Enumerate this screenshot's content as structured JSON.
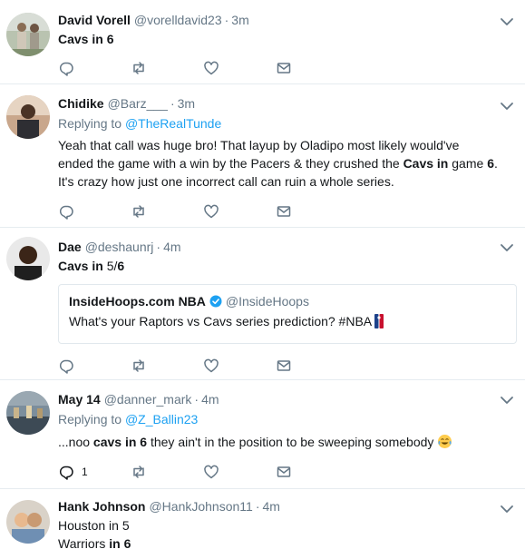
{
  "tweets": [
    {
      "name": "David Vorell",
      "handle": "@vorelldavid23",
      "sep": "·",
      "time": "3m",
      "text_html": "<b>Cavs in 6</b>",
      "actions": {
        "reply": "",
        "retweet": "",
        "like": "",
        "dm": ""
      }
    },
    {
      "name": "Chidike",
      "handle": "@Barz___",
      "sep": "·",
      "time": "3m",
      "replying_prefix": "Replying to ",
      "replying_to": "@TheRealTunde",
      "text_html": "Yeah that call was huge bro! That layup by Oladipo most likely would've ended the game with a win by the Pacers &amp; they crushed the <b>Cavs in</b> game <b>6</b>. It's crazy how just one incorrect call can ruin a whole series.",
      "actions": {
        "reply": "",
        "retweet": "",
        "like": "",
        "dm": ""
      }
    },
    {
      "name": "Dae",
      "handle": "@deshaunrj",
      "sep": "·",
      "time": "4m",
      "text_html": "<b>Cavs in</b> 5/<b>6</b>",
      "quote": {
        "name": "InsideHoops.com NBA",
        "handle": "@InsideHoops",
        "text": "What's your Raptors vs Cavs series prediction? #NBA"
      },
      "actions": {
        "reply": "",
        "retweet": "",
        "like": "",
        "dm": ""
      }
    },
    {
      "name": "May 14",
      "handle": "@danner_mark",
      "sep": "·",
      "time": "4m",
      "replying_prefix": "Replying to ",
      "replying_to": "@Z_Ballin23",
      "text_html": "...noo <b>cavs in 6</b> they ain't in the position to be sweeping somebody",
      "actions": {
        "reply": "1",
        "retweet": "",
        "like": "",
        "dm": ""
      }
    },
    {
      "name": "Hank Johnson",
      "handle": "@HankJohnson11",
      "sep": "·",
      "time": "4m",
      "text_html": "Houston in 5<br>Warriors <b>in 6</b>"
    }
  ],
  "icons": {
    "reply": "reply-icon",
    "retweet": "retweet-icon",
    "like": "like-icon",
    "dm": "direct-message-icon",
    "caret": "chevron-down-icon",
    "verified": "verified-badge-icon",
    "emoji_laugh": "tears-of-joy-emoji",
    "nba_logo": "nba-logo-icon"
  },
  "colors": {
    "text": "#14171a",
    "muted": "#657786",
    "link": "#1da1f2",
    "border": "#e6ecf0"
  }
}
